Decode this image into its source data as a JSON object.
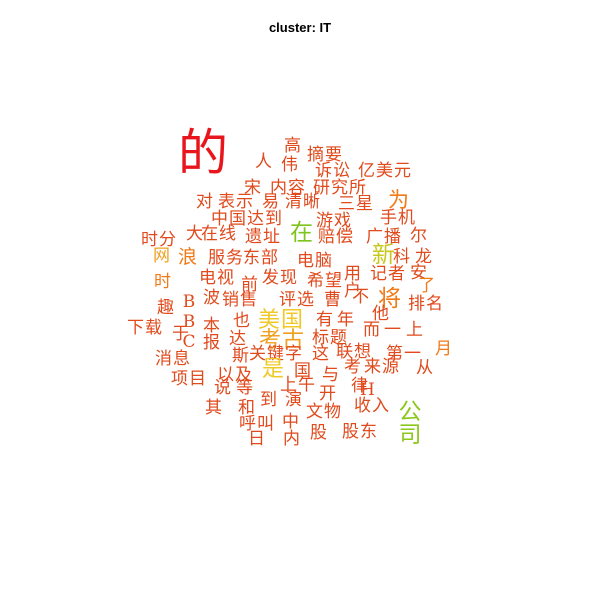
{
  "title": "cluster: IT",
  "words": [
    {
      "text": "的",
      "color": "#e8161c"
    },
    {
      "text": "高",
      "color": "#e04a1c"
    },
    {
      "text": "摘要",
      "color": "#e04a1c"
    },
    {
      "text": "人",
      "color": "#e04a1c"
    },
    {
      "text": "伟",
      "color": "#e04a1c"
    },
    {
      "text": "诉讼",
      "color": "#e04a1c"
    },
    {
      "text": "亿美元",
      "color": "#e04a1c"
    },
    {
      "text": "宋",
      "color": "#e04a1c"
    },
    {
      "text": "内容",
      "color": "#e04a1c"
    },
    {
      "text": "研究所",
      "color": "#e04a1c"
    },
    {
      "text": "为",
      "color": "#f07a18"
    },
    {
      "text": "对",
      "color": "#e04a1c"
    },
    {
      "text": "表示",
      "color": "#e04a1c"
    },
    {
      "text": "易",
      "color": "#e04a1c"
    },
    {
      "text": "清晰",
      "color": "#e04a1c"
    },
    {
      "text": "三星",
      "color": "#e04a1c"
    },
    {
      "text": "中国",
      "color": "#e04a1c"
    },
    {
      "text": "达到",
      "color": "#e04a1c"
    },
    {
      "text": "游戏",
      "color": "#e04a1c"
    },
    {
      "text": "手机",
      "color": "#e04a1c"
    },
    {
      "text": "大",
      "color": "#e04a1c"
    },
    {
      "text": "在线",
      "color": "#e04a1c"
    },
    {
      "text": "遗址",
      "color": "#e04a1c"
    },
    {
      "text": "在",
      "color": "#7dc41c"
    },
    {
      "text": "赔偿",
      "color": "#e04a1c"
    },
    {
      "text": "广播",
      "color": "#e04a1c"
    },
    {
      "text": "尔",
      "color": "#e04a1c"
    },
    {
      "text": "时分",
      "color": "#e04a1c"
    },
    {
      "text": "网",
      "color": "#f0a020"
    },
    {
      "text": "浪",
      "color": "#f07a18"
    },
    {
      "text": "服务",
      "color": "#e04a1c"
    },
    {
      "text": "东部",
      "color": "#e04a1c"
    },
    {
      "text": "电脑",
      "color": "#e04a1c"
    },
    {
      "text": "新",
      "color": "#c8c81c"
    },
    {
      "text": "科",
      "color": "#e04a1c"
    },
    {
      "text": "龙",
      "color": "#e04a1c"
    },
    {
      "text": "时",
      "color": "#f07a18"
    },
    {
      "text": "电视",
      "color": "#e04a1c"
    },
    {
      "text": "前",
      "color": "#e04a1c"
    },
    {
      "text": "发现",
      "color": "#e04a1c"
    },
    {
      "text": "希望",
      "color": "#e04a1c"
    },
    {
      "text": "用户",
      "color": "#e04a1c"
    },
    {
      "text": "记者",
      "color": "#e04a1c"
    },
    {
      "text": "安",
      "color": "#e04a1c"
    },
    {
      "text": "了",
      "color": "#f07a18"
    },
    {
      "text": "趣",
      "color": "#e04a1c"
    },
    {
      "text": "BBC",
      "color": "#e04a1c"
    },
    {
      "text": "波",
      "color": "#e04a1c"
    },
    {
      "text": "销售",
      "color": "#e04a1c"
    },
    {
      "text": "评选",
      "color": "#e04a1c"
    },
    {
      "text": "曹",
      "color": "#e04a1c"
    },
    {
      "text": "不",
      "color": "#e04a1c"
    },
    {
      "text": "将",
      "color": "#f07a18"
    },
    {
      "text": "排名",
      "color": "#e04a1c"
    },
    {
      "text": "下载",
      "color": "#e04a1c"
    },
    {
      "text": "于",
      "color": "#e04a1c"
    },
    {
      "text": "本报",
      "color": "#e04a1c"
    },
    {
      "text": "也",
      "color": "#e04a1c"
    },
    {
      "text": "美国",
      "color": "#f0c828"
    },
    {
      "text": "有",
      "color": "#e04a1c"
    },
    {
      "text": "年",
      "color": "#e04a1c"
    },
    {
      "text": "他",
      "color": "#e04a1c"
    },
    {
      "text": "达",
      "color": "#e04a1c"
    },
    {
      "text": "考古",
      "color": "#f0a020"
    },
    {
      "text": "标题",
      "color": "#e04a1c"
    },
    {
      "text": "而",
      "color": "#e04a1c"
    },
    {
      "text": "一",
      "color": "#e04a1c"
    },
    {
      "text": "上",
      "color": "#e04a1c"
    },
    {
      "text": "月",
      "color": "#f07a18"
    },
    {
      "text": "消息",
      "color": "#e04a1c"
    },
    {
      "text": "斯",
      "color": "#e04a1c"
    },
    {
      "text": "关键字",
      "color": "#e04a1c"
    },
    {
      "text": "这",
      "color": "#e04a1c"
    },
    {
      "text": "联想",
      "color": "#e04a1c"
    },
    {
      "text": "第一",
      "color": "#e04a1c"
    },
    {
      "text": "项目",
      "color": "#e04a1c"
    },
    {
      "text": "以及",
      "color": "#e04a1c"
    },
    {
      "text": "是",
      "color": "#f0c828"
    },
    {
      "text": "国",
      "color": "#e04a1c"
    },
    {
      "text": "与",
      "color": "#e04a1c"
    },
    {
      "text": "考",
      "color": "#e04a1c"
    },
    {
      "text": "来源",
      "color": "#e04a1c"
    },
    {
      "text": "从",
      "color": "#e04a1c"
    },
    {
      "text": "说",
      "color": "#e04a1c"
    },
    {
      "text": "等",
      "color": "#e04a1c"
    },
    {
      "text": "上午",
      "color": "#e04a1c"
    },
    {
      "text": "开",
      "color": "#e04a1c"
    },
    {
      "text": "律",
      "color": "#e04a1c"
    },
    {
      "text": "H",
      "color": "#e04a1c"
    },
    {
      "text": "公司",
      "color": "#8cc81c"
    },
    {
      "text": "其",
      "color": "#e04a1c"
    },
    {
      "text": "和",
      "color": "#e04a1c"
    },
    {
      "text": "到",
      "color": "#e04a1c"
    },
    {
      "text": "演",
      "color": "#e04a1c"
    },
    {
      "text": "文物",
      "color": "#e04a1c"
    },
    {
      "text": "收入",
      "color": "#e04a1c"
    },
    {
      "text": "呼叫",
      "color": "#e04a1c"
    },
    {
      "text": "中",
      "color": "#e04a1c"
    },
    {
      "text": "股",
      "color": "#e04a1c"
    },
    {
      "text": "股东",
      "color": "#e04a1c"
    },
    {
      "text": "日",
      "color": "#e04a1c"
    },
    {
      "text": "内",
      "color": "#e04a1c"
    }
  ]
}
